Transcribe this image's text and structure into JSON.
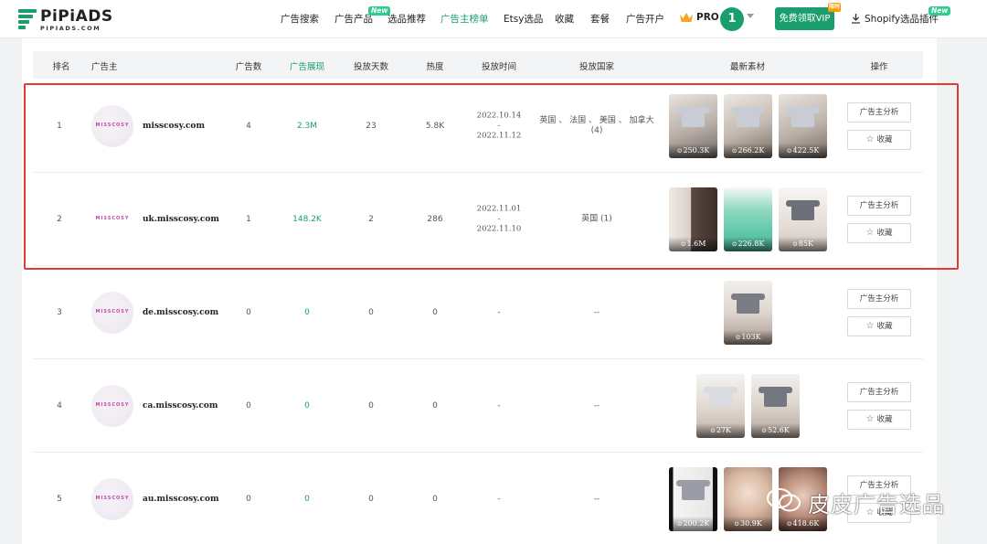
{
  "brand": {
    "name": "PiPiADS",
    "sub": "PIPIADS.COM"
  },
  "nav": {
    "items": [
      "广告搜索",
      "广告产品",
      "选品推荐",
      "广告主榜单",
      "Etsy选品",
      "收藏",
      "套餐",
      "广告开户"
    ],
    "new_badge": "New",
    "active_index": 3,
    "pro_label": "PRO",
    "avatar_initial": "1",
    "vip_button": "免费领取VIP",
    "vip_badge": "限时",
    "plugin_link": "Shopify选品插件",
    "plugin_new_badge": "New"
  },
  "table": {
    "headers": [
      "排名",
      "广告主",
      "广告数",
      "广告展现",
      "投放天数",
      "热度",
      "投放时间",
      "投放国家",
      "最新素材",
      "操作"
    ],
    "rows": [
      {
        "rank": "1",
        "domain": "misscosy.com",
        "logo_text": "MISSCOSY",
        "ads": "4",
        "impressions": "2.3M",
        "days": "23",
        "heat": "5.8K",
        "date_start": "2022.10.14",
        "date_sep": "-",
        "date_end": "2022.11.12",
        "countries": "英国 、 法国 、 美国 、 加拿大 (4)",
        "views": [
          "250.3K",
          "266.2K",
          "422.5K"
        ]
      },
      {
        "rank": "2",
        "domain": "uk.misscosy.com",
        "logo_text": "MISSCOSY",
        "ads": "1",
        "impressions": "148.2K",
        "days": "2",
        "heat": "286",
        "date_start": "2022.11.01",
        "date_sep": "-",
        "date_end": "2022.11.10",
        "countries": "英国 (1)",
        "views": [
          "1.6M",
          "226.8K",
          "85K"
        ]
      },
      {
        "rank": "3",
        "domain": "de.misscosy.com",
        "logo_text": "MISSCOSY",
        "ads": "0",
        "impressions": "0",
        "days": "0",
        "heat": "0",
        "date_single": "-",
        "countries": "--",
        "views": [
          "103K"
        ]
      },
      {
        "rank": "4",
        "domain": "ca.misscosy.com",
        "logo_text": "MISSCOSY",
        "ads": "0",
        "impressions": "0",
        "days": "0",
        "heat": "0",
        "date_single": "-",
        "countries": "--",
        "views": [
          "27K",
          "52.6K"
        ]
      },
      {
        "rank": "5",
        "domain": "au.misscosy.com",
        "logo_text": "MISSCOSY",
        "ads": "0",
        "impressions": "0",
        "days": "0",
        "heat": "0",
        "date_single": "-",
        "countries": "--",
        "views": [
          "200.2K",
          "30.9K",
          "418.6K"
        ]
      }
    ],
    "analyze_button": "广告主分析",
    "favorite_button": "收藏"
  },
  "watermark": "皮皮广告选品",
  "colors": {
    "accent": "#1a9e6e",
    "highlight": "#e53935"
  }
}
